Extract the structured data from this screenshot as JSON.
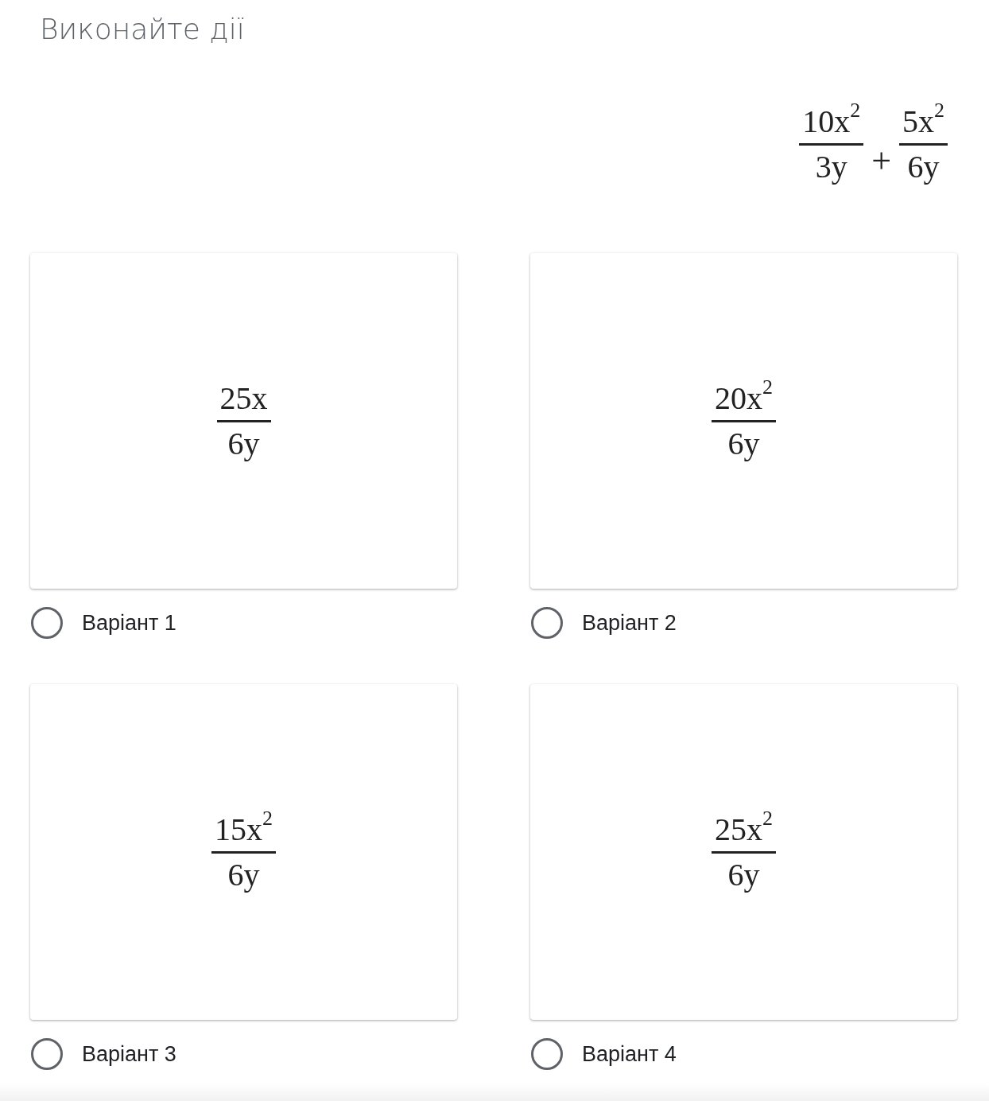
{
  "title": "Виконайте дії",
  "expression": {
    "terms": [
      {
        "numerator": "10x$^{2}$",
        "denominator": "3y"
      },
      {
        "numerator": "5x$^{2}$",
        "denominator": "6y"
      }
    ],
    "operator": "+"
  },
  "options": [
    {
      "numerator": "25x",
      "denominator": "6y",
      "label": "Варіант 1",
      "selected": false
    },
    {
      "numerator": "20x$^{2}$",
      "denominator": "6y",
      "label": "Варіант 2",
      "selected": false
    },
    {
      "numerator": "15x$^{2}$",
      "denominator": "6y",
      "label": "Варіант 3",
      "selected": false
    },
    {
      "numerator": "25x$^{2}$",
      "denominator": "6y",
      "label": "Варіант 4",
      "selected": false
    }
  ]
}
